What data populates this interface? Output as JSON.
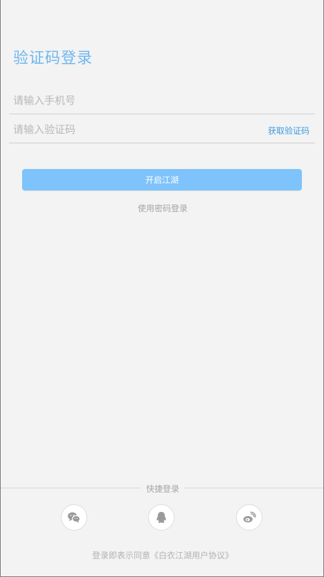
{
  "page_title": "验证码登录",
  "phone_field": {
    "placeholder": "请输入手机号",
    "value": ""
  },
  "code_field": {
    "placeholder": "请输入验证码",
    "value": ""
  },
  "get_code_label": "获取验证码",
  "submit_label": "开启江湖",
  "password_login_label": "使用密码登录",
  "quick_login_label": "快捷登录",
  "social": [
    {
      "icon": "wechat-icon"
    },
    {
      "icon": "qq-icon"
    },
    {
      "icon": "weibo-icon"
    }
  ],
  "agreement_text": "登录即表示同意《白衣江湖用户协议》",
  "colors": {
    "accent": "#6db7ef",
    "button": "#7ec3fb",
    "background": "#f3f3f3"
  }
}
